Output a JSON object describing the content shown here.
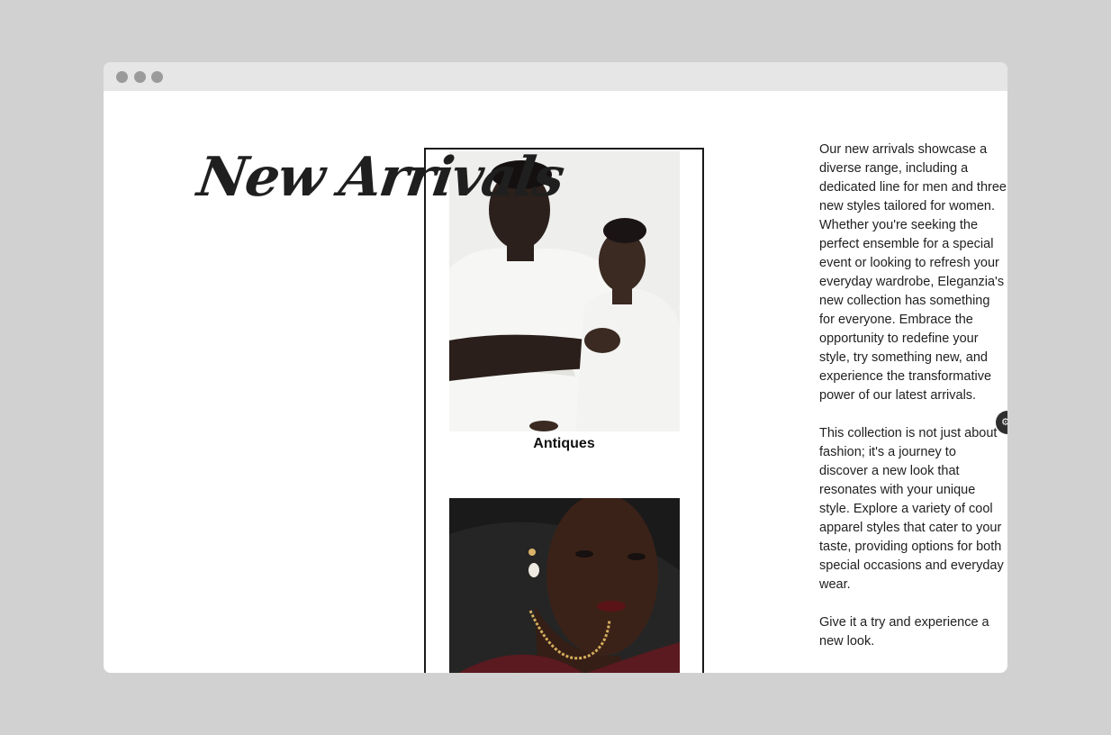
{
  "page": {
    "heading": "New Arrivals",
    "gallery": {
      "items": [
        {
          "caption": "Antiques",
          "image": "two-models-in-white-outfits"
        },
        {
          "caption": "",
          "image": "model-with-gold-necklace-and-pearl-earring"
        }
      ]
    },
    "description": {
      "paragraphs": [
        "Our new arrivals showcase a diverse range, including a dedicated line for men and three new styles tailored for women. Whether you're seeking the perfect ensemble for a special event or looking to refresh your everyday wardrobe, Eleganzia's new collection has something for everyone. Embrace the opportunity to redefine your style, try something new, and experience the transformative power of our latest arrivals.",
        "This collection is not just about fashion; it's a journey to discover a new look that resonates with your unique style. Explore a variety of cool apparel styles that cater to your taste, providing options for both special occasions and everyday wear.",
        "Give it a try and experience a new look."
      ]
    },
    "side_button": {
      "icon": "settings-icon"
    }
  },
  "colors": {
    "background": "#d1d1d1",
    "titlebar": "#e6e6e6",
    "window_dots": "#9b9b9b",
    "text": "#1f1f1f",
    "gallery_border": "#1a1a1a"
  }
}
